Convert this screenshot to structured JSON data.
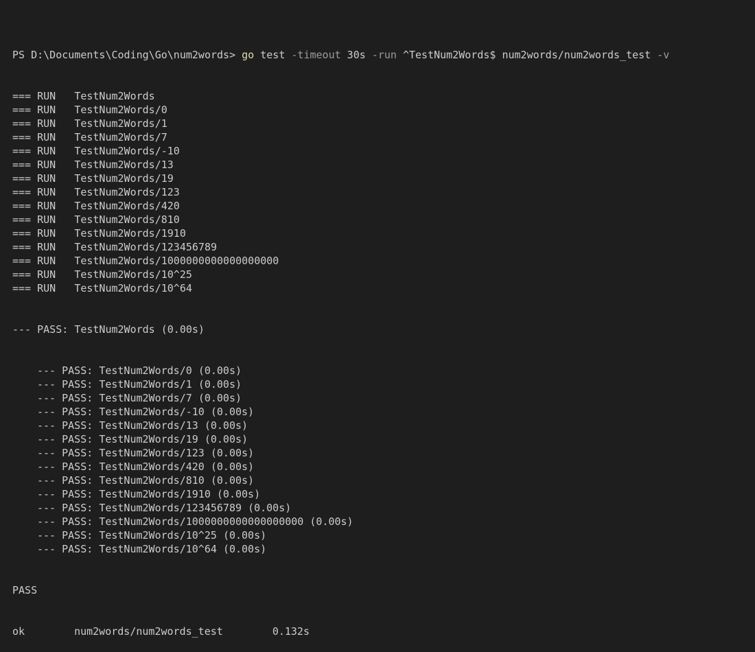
{
  "prompt": {
    "text": "PS D:\\Documents\\Coding\\Go\\num2words>",
    "exe": "go",
    "subcommand": "test",
    "flag_timeout": "-timeout",
    "timeout_value": "30s",
    "flag_run": "-run",
    "run_pattern": "^TestNum2Words$",
    "package": "num2words/num2words_test",
    "flag_v": "-v"
  },
  "run_prefix": "=== RUN",
  "run_lines": [
    "TestNum2Words",
    "TestNum2Words/0",
    "TestNum2Words/1",
    "TestNum2Words/7",
    "TestNum2Words/-10",
    "TestNum2Words/13",
    "TestNum2Words/19",
    "TestNum2Words/123",
    "TestNum2Words/420",
    "TestNum2Words/810",
    "TestNum2Words/1910",
    "TestNum2Words/123456789",
    "TestNum2Words/1000000000000000000",
    "TestNum2Words/10^25",
    "TestNum2Words/10^64"
  ],
  "pass_parent": {
    "prefix": "--- PASS:",
    "name": "TestNum2Words",
    "time": "(0.00s)"
  },
  "pass_prefix": "--- PASS:",
  "pass_lines": [
    {
      "name": "TestNum2Words/0",
      "time": "(0.00s)"
    },
    {
      "name": "TestNum2Words/1",
      "time": "(0.00s)"
    },
    {
      "name": "TestNum2Words/7",
      "time": "(0.00s)"
    },
    {
      "name": "TestNum2Words/-10",
      "time": "(0.00s)"
    },
    {
      "name": "TestNum2Words/13",
      "time": "(0.00s)"
    },
    {
      "name": "TestNum2Words/19",
      "time": "(0.00s)"
    },
    {
      "name": "TestNum2Words/123",
      "time": "(0.00s)"
    },
    {
      "name": "TestNum2Words/420",
      "time": "(0.00s)"
    },
    {
      "name": "TestNum2Words/810",
      "time": "(0.00s)"
    },
    {
      "name": "TestNum2Words/1910",
      "time": "(0.00s)"
    },
    {
      "name": "TestNum2Words/123456789",
      "time": "(0.00s)"
    },
    {
      "name": "TestNum2Words/1000000000000000000",
      "time": "(0.00s)"
    },
    {
      "name": "TestNum2Words/10^25",
      "time": "(0.00s)"
    },
    {
      "name": "TestNum2Words/10^64",
      "time": "(0.00s)"
    }
  ],
  "summary": {
    "pass": "PASS",
    "ok": "ok",
    "package": "num2words/num2words_test",
    "time": "0.132s"
  },
  "colors": {
    "background": "#1e1e1e",
    "foreground": "#cccccc",
    "command": "#dcdcaa",
    "flag": "#9c9c9c"
  }
}
